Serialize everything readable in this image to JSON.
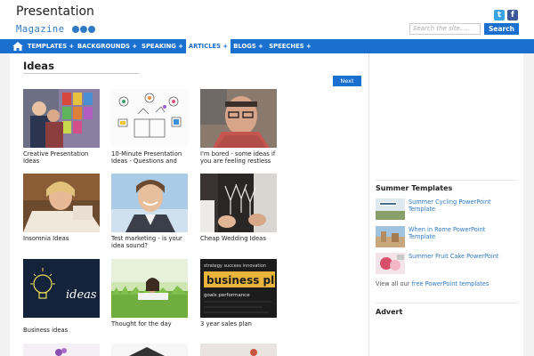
{
  "header": {
    "logo_title": "Presentation",
    "logo_sub": "Magazine",
    "search_placeholder": "Search the site.....",
    "search_button": "Search"
  },
  "nav": {
    "items": [
      {
        "label": "TEMPLATES +"
      },
      {
        "label": "BACKGROUNDS +"
      },
      {
        "label": "SPEAKING +"
      },
      {
        "label": "ARTICLES +"
      },
      {
        "label": "BLOGS +"
      },
      {
        "label": "SPEECHES +"
      }
    ],
    "active": "ARTICLES +"
  },
  "main": {
    "title": "Ideas",
    "next_label": "Next",
    "cards": [
      {
        "caption": "Creative Presentation Ideas"
      },
      {
        "caption": "10-Minute Presentation Ideas - Questions and Answers"
      },
      {
        "caption": "I'm bored - some ideas if you are feeling restless"
      },
      {
        "caption": "Insomnia Ideas"
      },
      {
        "caption": "Test marketing - is your idea sound?"
      },
      {
        "caption": "Cheap Wedding Ideas"
      },
      {
        "caption": "Business ideas"
      },
      {
        "caption": "Thought for the day"
      },
      {
        "caption": "3 year sales plan"
      }
    ],
    "thumb_texts": {
      "ideas": "ideas",
      "plan_words": "strategy  success  innovation",
      "plan_title": "business plan",
      "plan_sub": "goals  performance"
    }
  },
  "sidebar": {
    "heading": "Summer Templates",
    "items": [
      {
        "label": "Summer Cycling PowerPoint Template"
      },
      {
        "label": "When in Rome PowerPoint Template"
      },
      {
        "label": "Summer Fruit Cake PowerPoint"
      }
    ],
    "view_all_prefix": "View all our ",
    "view_all_link": "free PowerPoint templates",
    "advert": "Advert"
  },
  "colors": {
    "brand_blue": "#1a6fcf",
    "link_blue": "#2f7ac4"
  }
}
